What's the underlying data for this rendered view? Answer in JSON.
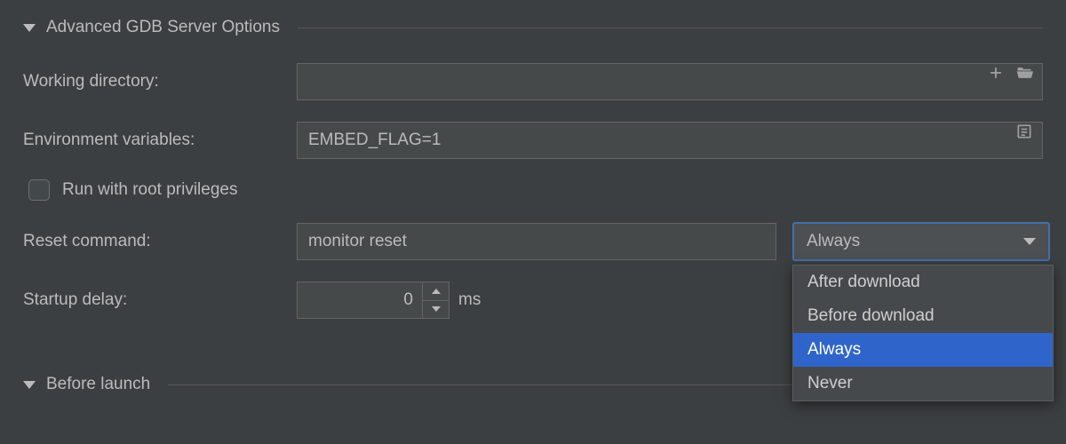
{
  "sections": {
    "advanced": {
      "title": "Advanced GDB Server Options"
    },
    "before_launch": {
      "title": "Before launch"
    }
  },
  "fields": {
    "working_directory": {
      "label": "Working directory:",
      "value": ""
    },
    "env_vars": {
      "label": "Environment variables:",
      "value": "EMBED_FLAG=1"
    },
    "root_priv": {
      "label": "Run with root privileges",
      "checked": false
    },
    "reset_command": {
      "label": "Reset command:",
      "value": "monitor reset"
    },
    "reset_mode": {
      "selected": "Always",
      "options": [
        "After download",
        "Before download",
        "Always",
        "Never"
      ]
    },
    "startup_delay": {
      "label": "Startup delay:",
      "value": "0",
      "unit": "ms"
    }
  }
}
